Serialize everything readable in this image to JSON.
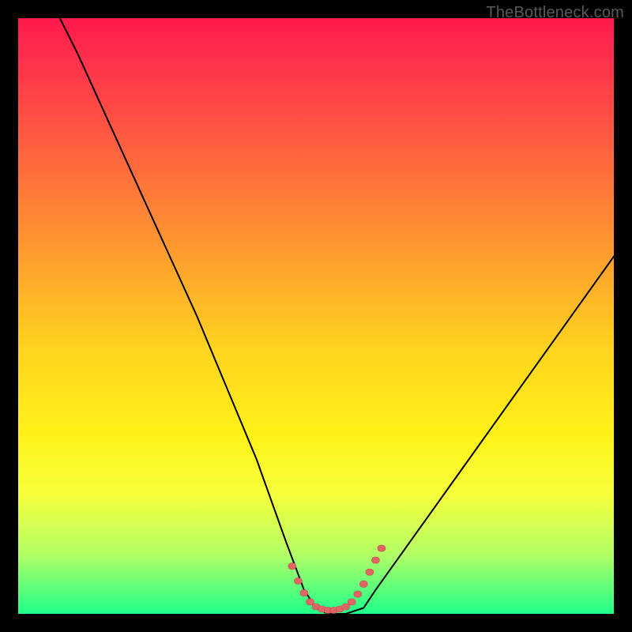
{
  "watermark": "TheBottleneck.com",
  "colors": {
    "page_bg": "#000000",
    "gradient_top": "#ff1a4d",
    "gradient_bottom": "#1fff8a",
    "curve_stroke": "#000000",
    "marker_fill": "#e06666",
    "marker_stroke": "#c04a4a"
  },
  "chart_data": {
    "type": "line",
    "title": "",
    "xlabel": "",
    "ylabel": "",
    "xlim": [
      0,
      100
    ],
    "ylim": [
      0,
      100
    ],
    "grid": false,
    "legend": false,
    "series": [
      {
        "name": "bottleneck-curve",
        "x": [
          7,
          10,
          15,
          20,
          25,
          30,
          35,
          40,
          45,
          48,
          50,
          52,
          55,
          58,
          60,
          65,
          70,
          75,
          80,
          85,
          90,
          95,
          100
        ],
        "y": [
          100,
          94,
          83,
          72,
          61,
          50,
          38,
          26,
          12,
          4,
          1,
          0,
          0,
          1,
          4,
          11,
          18,
          25,
          32,
          39,
          46,
          53,
          60
        ]
      }
    ],
    "markers": {
      "name": "highlight-notch",
      "x": [
        46,
        47,
        48,
        49,
        50,
        51,
        52,
        53,
        54,
        55,
        56,
        57,
        58,
        59,
        60,
        61
      ],
      "y": [
        8,
        5.5,
        3.5,
        2,
        1.2,
        0.8,
        0.6,
        0.6,
        0.8,
        1.2,
        2,
        3.3,
        5,
        7,
        9,
        11
      ],
      "color": "#e06666"
    },
    "annotations": []
  }
}
